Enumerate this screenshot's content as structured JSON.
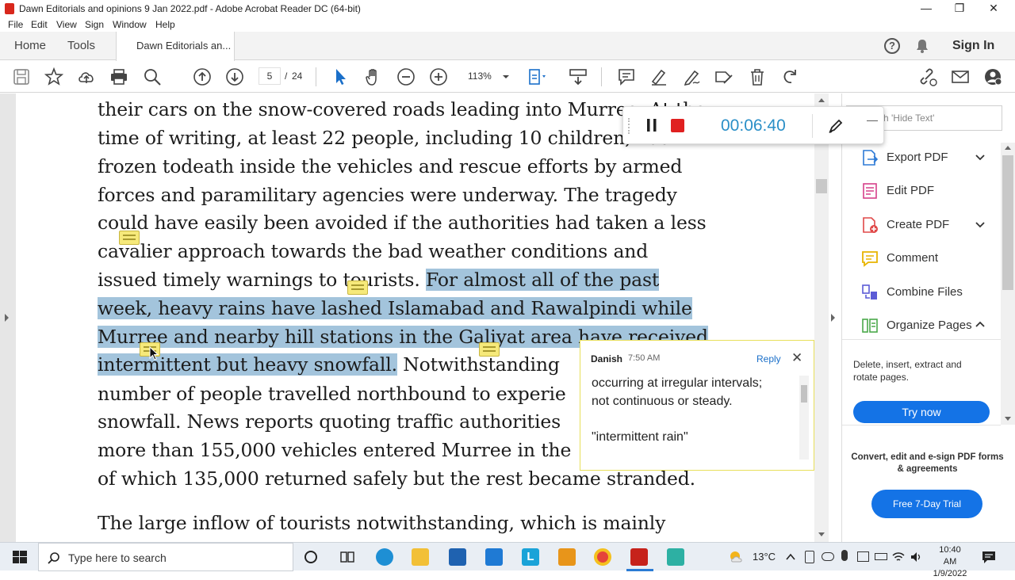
{
  "window": {
    "title": "Dawn Editorials and opinions 9 Jan 2022.pdf - Adobe Acrobat Reader DC (64-bit)",
    "minimize": "—",
    "restore": "❐",
    "close": "✕"
  },
  "menu": [
    "File",
    "Edit",
    "View",
    "Sign",
    "Window",
    "Help"
  ],
  "tabs": {
    "home": "Home",
    "tools": "Tools",
    "document": "Dawn Editorials an...",
    "help": "?",
    "sign_in": "Sign In"
  },
  "toolbar": {
    "current_page": "5",
    "page_sep": "/",
    "total_pages": "24",
    "zoom": "113%"
  },
  "document": {
    "lines": [
      "their cars on the snow-covered roads leading into Murree. At the",
      "time of writing, at least 22 people, including 10 children, had",
      "frozen todeath inside the vehicles and rescue efforts by armed",
      "forces and paramilitary agencies were underway. The tragedy",
      "could have easily been avoided if the authorities had taken a less",
      "cavalier approach towards the bad weather conditions and"
    ],
    "line7_plain": "issued timely warnings to tourists. ",
    "line7_highlight": "For almost all of the past",
    "line8_highlight": "week, heavy rains have lashed Islamabad and Rawalpindi while",
    "line9_highlight": "Murree and nearby hill stations in the Galiyat area have received",
    "line10_highlight": "intermittent but heavy snowfall.",
    "line10_plain": " Notwithstanding",
    "line11": "number of people travelled northbound to experie",
    "line12": "snowfall. News reports quoting traffic authorities",
    "line13": "more than 155,000 vehicles entered Murree in the",
    "line14": "of which 135,000 returned safely but the rest became stranded.",
    "line15": "The large inflow of tourists notwithstanding, which is mainly"
  },
  "recorder": {
    "timer": "00:06:40",
    "collapse": "—"
  },
  "comment": {
    "author": "Danish",
    "time": "7:50 AM",
    "reply": "Reply",
    "close": "✕",
    "line1": "occurring at irregular intervals;",
    "line2": "not continuous or steady.",
    "line3": "\"intermittent rain\""
  },
  "right_panel": {
    "search_placeholder": "ch 'Hide Text'",
    "tools": [
      {
        "label": "Export PDF",
        "color": "#2d7ad6"
      },
      {
        "label": "Edit PDF",
        "color": "#d6408a"
      },
      {
        "label": "Create PDF",
        "color": "#e04848"
      },
      {
        "label": "Comment",
        "color": "#e8b400"
      },
      {
        "label": "Combine Files",
        "color": "#5b5bd6"
      },
      {
        "label": "Organize Pages",
        "color": "#4aa84a"
      }
    ],
    "organize_desc": "Delete, insert, extract and rotate pages.",
    "try_now": "Try now",
    "promo": "Convert, edit and e-sign PDF forms & agreements",
    "trial": "Free 7-Day Trial"
  },
  "taskbar": {
    "search_placeholder": "Type here to search",
    "temperature": "13°C",
    "time": "10:40 AM",
    "date": "1/9/2022"
  }
}
